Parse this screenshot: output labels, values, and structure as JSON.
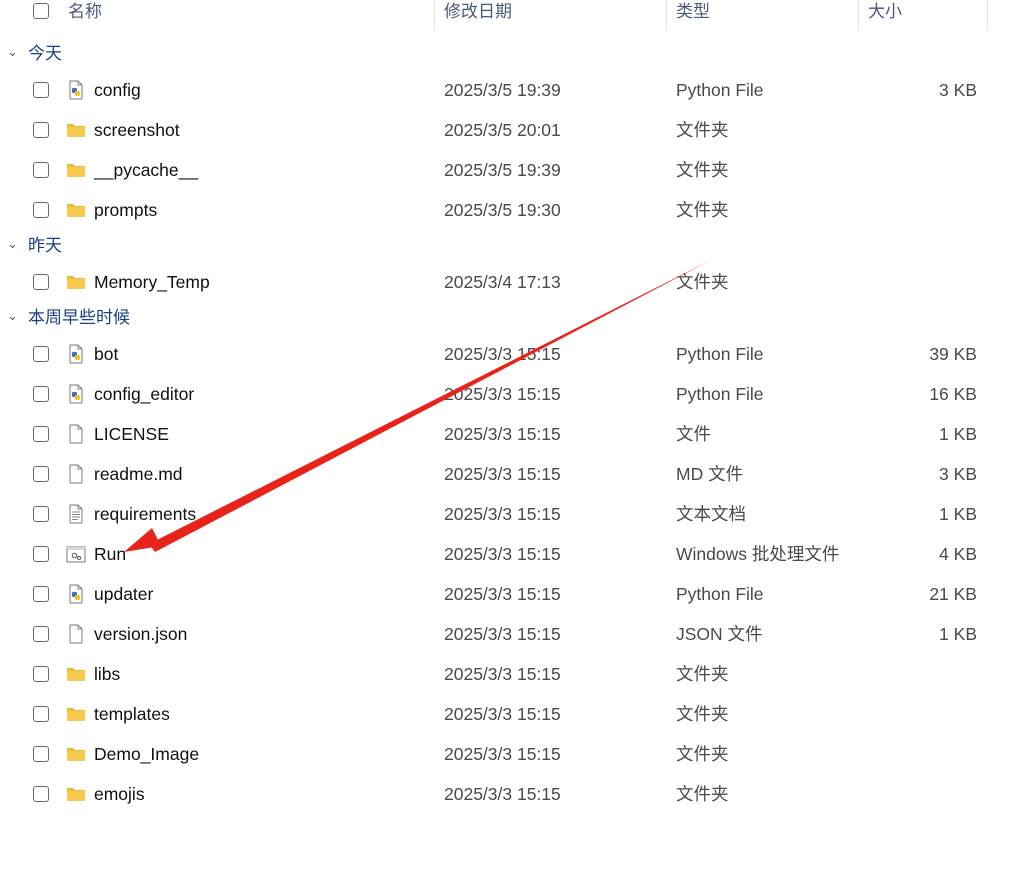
{
  "header": {
    "name": "名称",
    "date_modified": "修改日期",
    "type": "类型",
    "size": "大小"
  },
  "groups": [
    {
      "label": "今天",
      "files": [
        {
          "name": "config",
          "date": "2025/3/5 19:39",
          "type": "Python File",
          "size": "3 KB",
          "icon": "python-file-icon"
        },
        {
          "name": "screenshot",
          "date": "2025/3/5 20:01",
          "type": "文件夹",
          "size": "",
          "icon": "folder-icon"
        },
        {
          "name": "__pycache__",
          "date": "2025/3/5 19:39",
          "type": "文件夹",
          "size": "",
          "icon": "folder-icon"
        },
        {
          "name": "prompts",
          "date": "2025/3/5 19:30",
          "type": "文件夹",
          "size": "",
          "icon": "folder-icon"
        }
      ]
    },
    {
      "label": "昨天",
      "files": [
        {
          "name": "Memory_Temp",
          "date": "2025/3/4 17:13",
          "type": "文件夹",
          "size": "",
          "icon": "folder-icon"
        }
      ]
    },
    {
      "label": "本周早些时候",
      "files": [
        {
          "name": "bot",
          "date": "2025/3/3 15:15",
          "type": "Python File",
          "size": "39 KB",
          "icon": "python-file-icon"
        },
        {
          "name": "config_editor",
          "date": "2025/3/3 15:15",
          "type": "Python File",
          "size": "16 KB",
          "icon": "python-file-icon"
        },
        {
          "name": "LICENSE",
          "date": "2025/3/3 15:15",
          "type": "文件",
          "size": "1 KB",
          "icon": "blank-file-icon"
        },
        {
          "name": "readme.md",
          "date": "2025/3/3 15:15",
          "type": "MD 文件",
          "size": "3 KB",
          "icon": "blank-file-icon"
        },
        {
          "name": "requirements",
          "date": "2025/3/3 15:15",
          "type": "文本文档",
          "size": "1 KB",
          "icon": "text-file-icon"
        },
        {
          "name": "Run",
          "date": "2025/3/3 15:15",
          "type": "Windows 批处理文件",
          "size": "4 KB",
          "icon": "batch-file-icon"
        },
        {
          "name": "updater",
          "date": "2025/3/3 15:15",
          "type": "Python File",
          "size": "21 KB",
          "icon": "python-file-icon"
        },
        {
          "name": "version.json",
          "date": "2025/3/3 15:15",
          "type": "JSON 文件",
          "size": "1 KB",
          "icon": "blank-file-icon"
        },
        {
          "name": "libs",
          "date": "2025/3/3 15:15",
          "type": "文件夹",
          "size": "",
          "icon": "folder-icon"
        },
        {
          "name": "templates",
          "date": "2025/3/3 15:15",
          "type": "文件夹",
          "size": "",
          "icon": "folder-icon"
        },
        {
          "name": "Demo_Image",
          "date": "2025/3/3 15:15",
          "type": "文件夹",
          "size": "",
          "icon": "folder-icon"
        },
        {
          "name": "emojis",
          "date": "2025/3/3 15:15",
          "type": "文件夹",
          "size": "",
          "icon": "folder-icon"
        }
      ]
    }
  ],
  "colors": {
    "group_label": "#1b3f86",
    "arrow": "#e8231a",
    "folder": "#f6c445"
  }
}
